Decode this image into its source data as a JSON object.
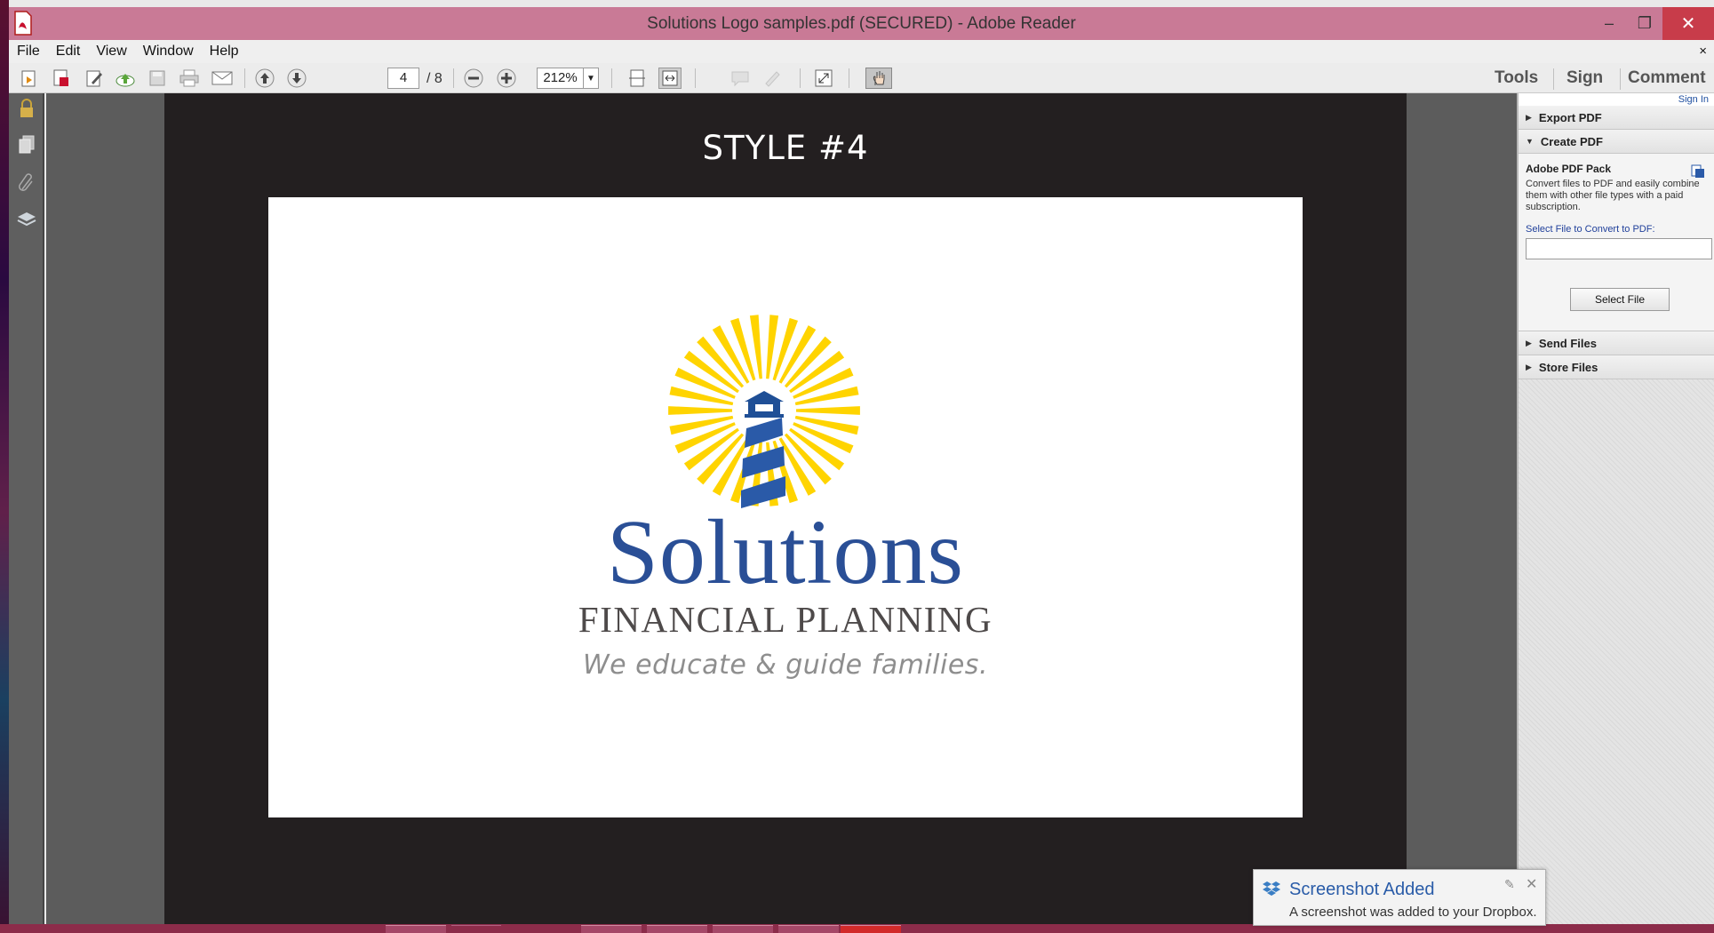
{
  "window": {
    "title": "Solutions Logo samples.pdf (SECURED) - Adobe Reader",
    "minimize": "‒",
    "maximize": "❐",
    "close": "✕"
  },
  "menu": {
    "items": [
      "File",
      "Edit",
      "View",
      "Window",
      "Help"
    ],
    "close_doc": "×"
  },
  "toolbar": {
    "current_page": "4",
    "total_pages": "/ 8",
    "zoom": "212%",
    "tools_label": "Tools",
    "sign_label": "Sign",
    "comment_label": "Comment",
    "icons": [
      "open-icon",
      "create-pdf-icon",
      "edit-icon",
      "upload-icon",
      "save-icon",
      "print-icon",
      "email-icon",
      "prev-page-icon",
      "next-page-icon",
      "zoom-out-icon",
      "zoom-in-icon",
      "fit-page-icon",
      "fit-width-icon",
      "sticky-note-icon",
      "highlight-icon",
      "fullscreen-icon",
      "hand-tool-icon"
    ]
  },
  "document": {
    "heading": "STYLE #4",
    "logo": {
      "word": "Solutions",
      "subtitle": "FINANCIAL PLANNING",
      "tagline": "We educate & guide families.",
      "sun_color": "#FFD400",
      "brand_blue": "#2A4F96"
    }
  },
  "rightpane": {
    "sign_in": "Sign In",
    "export_pdf": "Export PDF",
    "create_pdf": "Create PDF",
    "pack_title": "Adobe PDF Pack",
    "pack_desc": "Convert files to PDF and easily combine them with other file types with a paid subscription.",
    "select_label": "Select File to Convert to PDF:",
    "select_button": "Select File",
    "send_files": "Send Files",
    "store_files": "Store Files"
  },
  "notification": {
    "title": "Screenshot Added",
    "body": "A screenshot was added to your Dropbox.",
    "close": "✕"
  }
}
